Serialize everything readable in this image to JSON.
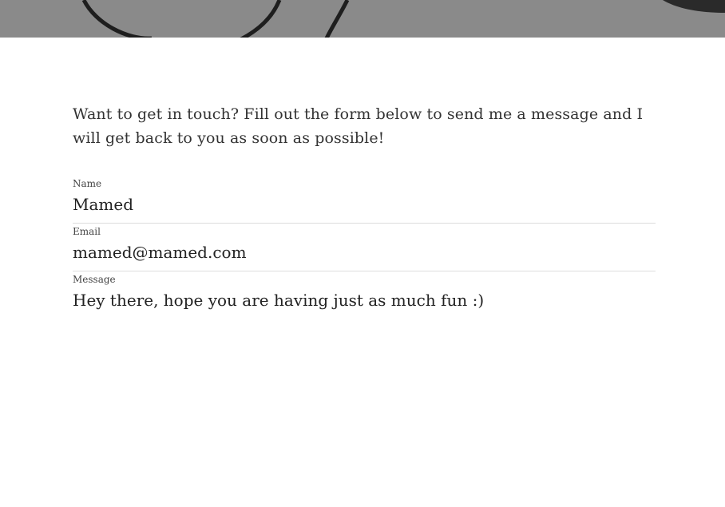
{
  "intro": {
    "text": "Want to get in touch? Fill out the form below to send me a message and I will get back to you as soon as possible!"
  },
  "form": {
    "name": {
      "label": "Name",
      "value": "Mamed"
    },
    "email": {
      "label": "Email",
      "value": "mamed@mamed.com"
    },
    "message": {
      "label": "Message",
      "value": "Hey there, hope you are having just as much fun :)"
    }
  },
  "colors": {
    "hero_background": "#8a8a8a",
    "divider": "#dddddd",
    "text": "#333333"
  }
}
